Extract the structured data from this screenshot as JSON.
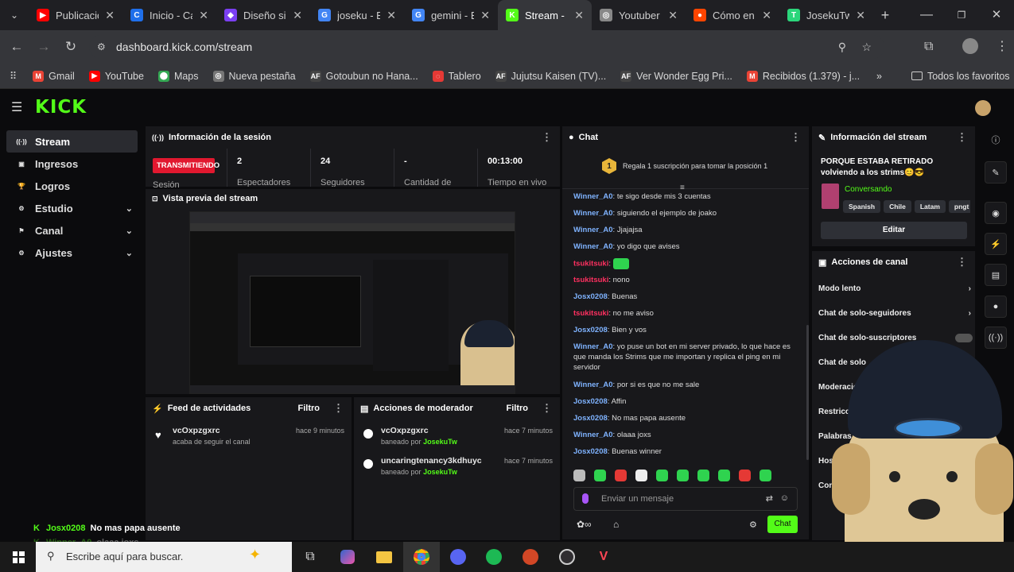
{
  "tabs": [
    {
      "title": "Publicació",
      "color": "#ff0000",
      "glyph": "▶"
    },
    {
      "title": "Inicio - Ca",
      "color": "#1f6feb",
      "glyph": "C"
    },
    {
      "title": "Diseño sin",
      "color": "#7b3ff2",
      "glyph": "◆"
    },
    {
      "title": "joseku - B",
      "color": "#4285f4",
      "glyph": "G"
    },
    {
      "title": "gemini - B",
      "color": "#4285f4",
      "glyph": "G"
    },
    {
      "title": "Stream - K",
      "color": "#53fc18",
      "glyph": "K"
    },
    {
      "title": "Youtuber",
      "color": "#888888",
      "glyph": "◎"
    },
    {
      "title": "Cómo en",
      "color": "#ff4500",
      "glyph": "●"
    },
    {
      "title": "JosekuTw",
      "color": "#2bd67b",
      "glyph": "T"
    }
  ],
  "url": "dashboard.kick.com/stream",
  "bookmarks": [
    {
      "label": "Gmail",
      "color": "#ea4335",
      "glyph": "M"
    },
    {
      "label": "YouTube",
      "color": "#ff0000",
      "glyph": "▶"
    },
    {
      "label": "Maps",
      "color": "#34a853",
      "glyph": "⬤"
    },
    {
      "label": "Nueva pestaña",
      "color": "#777777",
      "glyph": "◎"
    },
    {
      "label": "Gotoubun no Hana...",
      "color": "#444444",
      "glyph": "AF"
    },
    {
      "label": "Tablero",
      "color": "#e53935",
      "glyph": "◌"
    },
    {
      "label": "Jujutsu Kaisen (TV)...",
      "color": "#444444",
      "glyph": "AF"
    },
    {
      "label": "Ver Wonder Egg Pri...",
      "color": "#444444",
      "glyph": "AF"
    },
    {
      "label": "Recibidos (1.379) - j...",
      "color": "#ea4335",
      "glyph": "M"
    }
  ],
  "bookmarks_more": "»",
  "bookmarks_folder": "Todos los favoritos",
  "logo": "KICK",
  "sidebar": [
    {
      "label": "Stream",
      "icon": "((·))",
      "active": true,
      "chev": ""
    },
    {
      "label": "Ingresos",
      "icon": "▣",
      "active": false,
      "chev": ""
    },
    {
      "label": "Logros",
      "icon": "🏆",
      "active": false,
      "chev": ""
    },
    {
      "label": "Estudio",
      "icon": "⚙",
      "active": false,
      "chev": "⌄"
    },
    {
      "label": "Canal",
      "icon": "⚑",
      "active": false,
      "chev": "⌄"
    },
    {
      "label": "Ajustes",
      "icon": "⚙",
      "active": false,
      "chev": "⌄"
    }
  ],
  "session": {
    "title": "Información de la sesión",
    "live_badge": "TRANSMITIENDO",
    "live_label": "Sesión",
    "stats": [
      {
        "value": "2",
        "label": "Espectadores"
      },
      {
        "value": "24",
        "label": "Seguidores"
      },
      {
        "value": "-",
        "label": "Cantidad de"
      },
      {
        "value": "00:13:00",
        "label": "Tiempo en vivo"
      }
    ]
  },
  "preview": {
    "title": "Vista previa del stream"
  },
  "feed": {
    "title": "Feed de actividades",
    "filter": "Filtro",
    "items": [
      {
        "user": "vcOxpzgxrc",
        "desc": "acaba de seguir el canal",
        "time": "hace 9 minutos"
      }
    ]
  },
  "modactions": {
    "title": "Acciones de moderador",
    "filter": "Filtro",
    "items": [
      {
        "user": "vcOxpzgxrc",
        "desc": "baneado por",
        "by": "JosekuTw",
        "time": "hace 7 minutos"
      },
      {
        "user": "uncaringtenancy3kdhuyc",
        "desc": "baneado por",
        "by": "JosekuTw",
        "time": "hace 7 minutos"
      }
    ]
  },
  "chat": {
    "title": "Chat",
    "pinned_rank": "1",
    "pinned_text": "Regala 1 suscripción para tomar la posición 1",
    "messages": [
      {
        "user": "Winner_A0",
        "color": "#7fb3ff",
        "text": "te sigo desde mis 3 cuentas"
      },
      {
        "user": "Winner_A0",
        "color": "#7fb3ff",
        "text": "siguiendo el ejemplo de joako"
      },
      {
        "user": "Winner_A0",
        "color": "#7fb3ff",
        "text": "Jjajajsa"
      },
      {
        "user": "Winner_A0",
        "color": "#7fb3ff",
        "text": "yo digo que avises"
      },
      {
        "user": "tsukitsuki",
        "color": "#ff3060",
        "text": "[emote]"
      },
      {
        "user": "tsukitsuki",
        "color": "#ff3060",
        "text": "nono"
      },
      {
        "user": "Josx0208",
        "color": "#7fb3ff",
        "text": "Buenas"
      },
      {
        "user": "tsukitsuki",
        "color": "#ff3060",
        "text": "no me aviso"
      },
      {
        "user": "Josx0208",
        "color": "#7fb3ff",
        "text": "Bien y vos"
      },
      {
        "user": "Winner_A0",
        "color": "#7fb3ff",
        "text": "yo puse un bot en mi server privado, lo que hace es que manda los Strims que me importan y replica el ping en mi servidor"
      },
      {
        "user": "Winner_A0",
        "color": "#7fb3ff",
        "text": "por si es que no me sale"
      },
      {
        "user": "Josx0208",
        "color": "#7fb3ff",
        "text": "Affin"
      },
      {
        "user": "Josx0208",
        "color": "#7fb3ff",
        "text": "No mas papa ausente"
      },
      {
        "user": "Winner_A0",
        "color": "#7fb3ff",
        "text": "olaaa joxs"
      },
      {
        "user": "Josx0208",
        "color": "#7fb3ff",
        "text": "Buenas winner"
      }
    ],
    "input_placeholder": "Enviar un mensaje",
    "send_button": "Chat"
  },
  "stream_info": {
    "title": "Información del stream",
    "stream_title": "PORQUE ESTABA RETIRADO volviendo a los strims😊😎",
    "category": "Conversando",
    "tags": [
      "Spanish",
      "Chile",
      "Latam",
      "pngt"
    ],
    "edit_button": "Editar"
  },
  "channel_actions": {
    "title": "Acciones de canal",
    "items": [
      "Modo lento",
      "Chat de solo-seguidores",
      "Chat de solo-suscriptores",
      "Chat de solo",
      "Moderación",
      "Restricción",
      "Palabras",
      "Hoster",
      "Configuración"
    ]
  },
  "overlay_chat": [
    {
      "user": "Josx0208",
      "text": "No mas papa ausente"
    },
    {
      "user": "Winner_A0",
      "text": "olaaa joxs"
    }
  ],
  "taskbar": {
    "search_placeholder": "Escribe aquí para buscar."
  },
  "colors": {
    "kick_green": "#53fc18",
    "live_red": "#e1182f",
    "panel": "#18181b",
    "bg": "#0b0b0d"
  }
}
